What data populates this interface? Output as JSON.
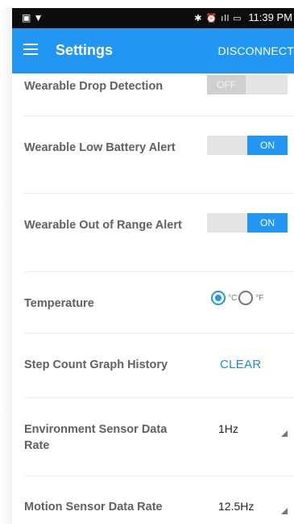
{
  "status_bar": {
    "left_icons": "▣ ▼",
    "right_icons": "✱ ⏰ ıll ▭",
    "time": "11:39 PM"
  },
  "app_bar": {
    "title": "Settings",
    "action": "DISCONNECT"
  },
  "settings": {
    "drop_detection": {
      "label": "Wearable Drop Detection",
      "state": "OFF"
    },
    "low_battery": {
      "label": "Wearable Low Battery Alert",
      "state": "ON"
    },
    "out_of_range": {
      "label": "Wearable Out of Range Alert",
      "state": "ON"
    },
    "temperature": {
      "label": "Temperature",
      "celsius": "°C",
      "fahrenheit": "°F",
      "selected": "celsius"
    },
    "step_history": {
      "label": "Step Count Graph History",
      "action": "CLEAR"
    },
    "env_rate": {
      "label": "Environment Sensor Data Rate",
      "value": "1Hz"
    },
    "motion_rate": {
      "label": "Motion Sensor Data Rate",
      "value": "12.5Hz"
    }
  },
  "colors": {
    "accent": "#2196f3",
    "status_bar": "#0d0d0d",
    "label_text": "#616161"
  },
  "icons": [
    "menu-icon",
    "dropdown-arrow-icon",
    "radio-checked-icon",
    "radio-unchecked-icon"
  ]
}
